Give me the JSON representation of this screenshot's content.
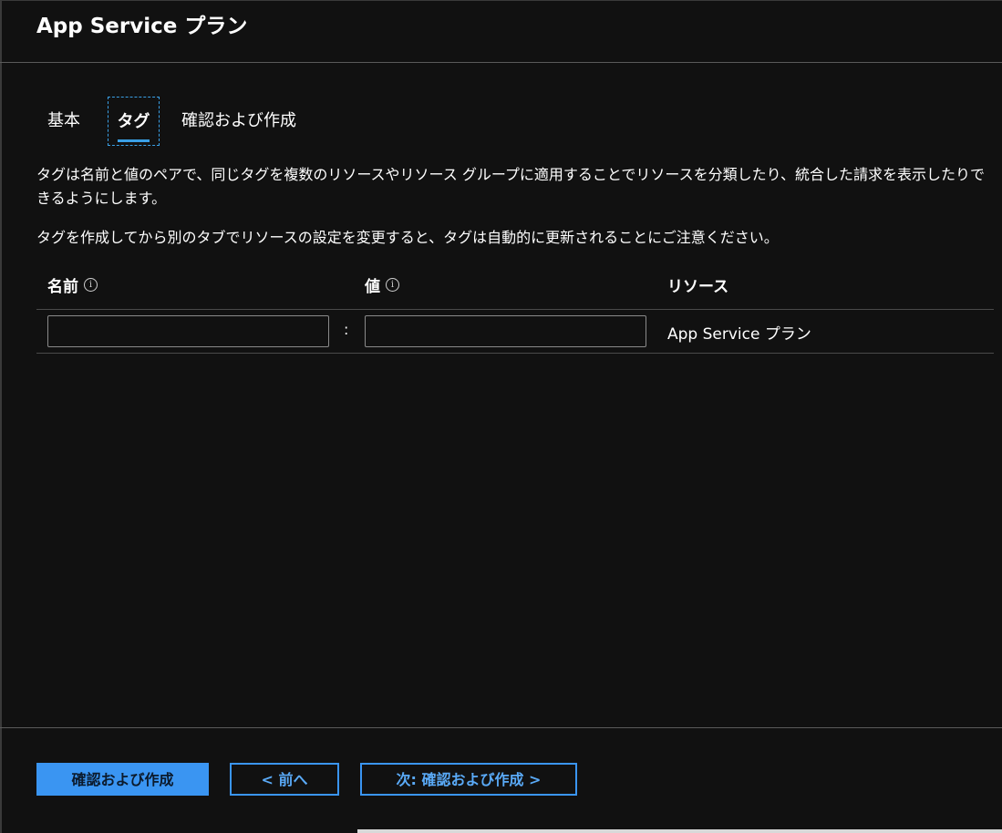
{
  "header": {
    "title": "App Service プラン"
  },
  "tabs": [
    {
      "label": "基本",
      "selected": false
    },
    {
      "label": "タグ",
      "selected": true
    },
    {
      "label": "確認および作成",
      "selected": false
    }
  ],
  "description": {
    "line1": "タグは名前と値のペアで、同じタグを複数のリソースやリソース グループに適用することでリソースを分類したり、統合した請求を表示したりできるようにします。",
    "line2": "タグを作成してから別のタブでリソースの設定を変更すると、タグは自動的に更新されることにご注意ください。"
  },
  "table": {
    "headers": {
      "name": "名前",
      "value": "値",
      "resource": "リソース"
    },
    "rows": [
      {
        "name": "",
        "value": "",
        "separator": ":",
        "resource": "App Service プラン"
      }
    ]
  },
  "icons": {
    "info": "info-icon",
    "info_glyph": "i"
  },
  "footer": {
    "review_create_label": "確認および作成",
    "previous_label": "< 前へ",
    "next_label": "次: 確認および作成 >"
  },
  "colors": {
    "accent": "#3a95f2",
    "background": "#111111"
  }
}
